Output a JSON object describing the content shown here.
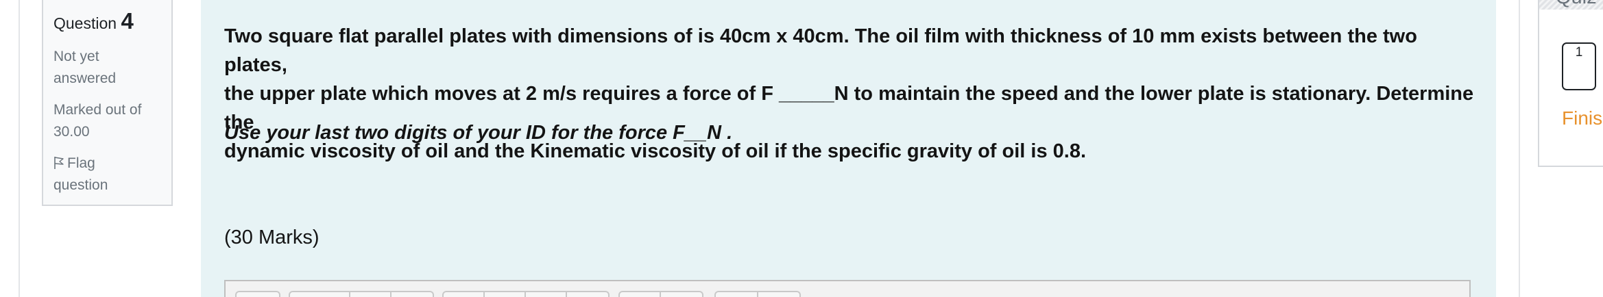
{
  "question_info": {
    "label": "Question",
    "number": "4",
    "state_line1": "Not yet",
    "state_line2": "answered",
    "grade_line1": "Marked out of",
    "grade_line2": "30.00",
    "flag_line1": "Flag",
    "flag_line2": "question"
  },
  "question": {
    "line1": "Two square flat parallel plates with dimensions of is 40cm x 40cm. The oil film with thickness of 10 mm exists between the two plates,",
    "line2": "the upper plate which moves at 2 m/s requires a force of F _____N to maintain the speed and the lower plate is stationary. Determine the",
    "line3": "dynamic viscosity of oil and the Kinematic viscosity of oil if the specific gravity of oil is 0.8.",
    "note": "Use your last two digits of your ID for the force F__N .",
    "marks": "(30 Marks)"
  },
  "quiz_nav": {
    "title": "Quiz",
    "question_button": "1",
    "finish": "Finis"
  },
  "colors": {
    "content_bg": "#e7f3f5",
    "finish_link": "#e8912c"
  }
}
